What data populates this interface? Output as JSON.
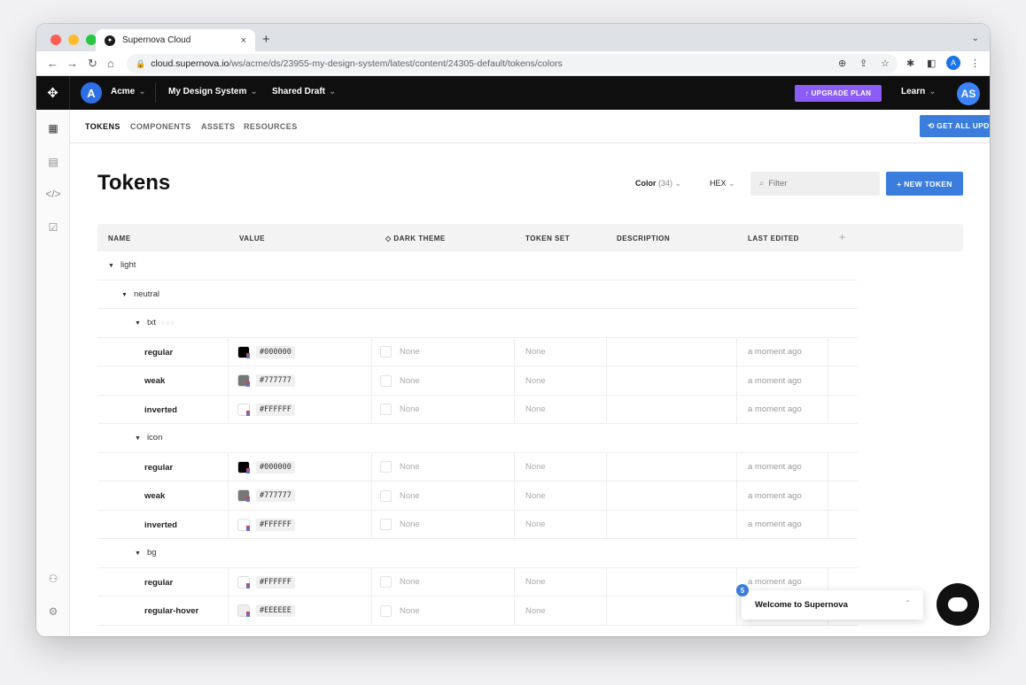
{
  "browser": {
    "tab_title": "Supernova Cloud",
    "tab_close": "×",
    "new_tab": "+",
    "url_host": "cloud.supernova.io",
    "url_path": "/ws/acme/ds/23955-my-design-system/latest/content/24305-default/tokens/colors",
    "profile_initial": "A"
  },
  "appnav": {
    "workspace_initial": "A",
    "workspace": "Acme",
    "design_system": "My Design System",
    "draft": "Shared Draft",
    "upgrade": "↑  UPGRADE PLAN",
    "learn": "Learn",
    "user_initials": "AS"
  },
  "subnav": {
    "tabs": [
      "TOKENS",
      "COMPONENTS",
      "ASSETS",
      "RESOURCES"
    ],
    "get_updates": "⟲  GET ALL UPDATES"
  },
  "page": {
    "title": "Tokens",
    "color_filter_label": "Color",
    "color_filter_count": "(34)",
    "format": "HEX",
    "filter_placeholder": "Filter",
    "new_token": "+  NEW TOKEN"
  },
  "table": {
    "headers": [
      "NAME",
      "VALUE",
      "DARK THEME",
      "TOKEN SET",
      "DESCRIPTION",
      "LAST EDITED"
    ],
    "groups": {
      "light": "light",
      "neutral": "neutral",
      "txt": "txt",
      "icon": "icon",
      "bg": "bg"
    },
    "rows": [
      {
        "name": "regular",
        "hex": "#000000",
        "color": "#000000",
        "dark": "None",
        "set": "None",
        "edited": "a moment ago"
      },
      {
        "name": "weak",
        "hex": "#777777",
        "color": "#777777",
        "dark": "None",
        "set": "None",
        "edited": "a moment ago"
      },
      {
        "name": "inverted",
        "hex": "#FFFFFF",
        "color": "#FFFFFF",
        "dark": "None",
        "set": "None",
        "edited": "a moment ago"
      },
      {
        "name": "regular",
        "hex": "#000000",
        "color": "#000000",
        "dark": "None",
        "set": "None",
        "edited": "a moment ago"
      },
      {
        "name": "weak",
        "hex": "#777777",
        "color": "#777777",
        "dark": "None",
        "set": "None",
        "edited": "a moment ago"
      },
      {
        "name": "inverted",
        "hex": "#FFFFFF",
        "color": "#FFFFFF",
        "dark": "None",
        "set": "None",
        "edited": "a moment ago"
      },
      {
        "name": "regular",
        "hex": "#FFFFFF",
        "color": "#FFFFFF",
        "dark": "None",
        "set": "None",
        "edited": "a moment ago"
      },
      {
        "name": "regular-hover",
        "hex": "#EEEEEE",
        "color": "#EEEEEE",
        "dark": "None",
        "set": "None",
        "edited": ""
      }
    ]
  },
  "widget": {
    "welcome": "Welcome to Supernova",
    "badge": "5"
  },
  "colors": {
    "accent": "#3b7ddd",
    "upgrade": "#8b5cf6",
    "appnav_bg": "#0f0f10"
  }
}
